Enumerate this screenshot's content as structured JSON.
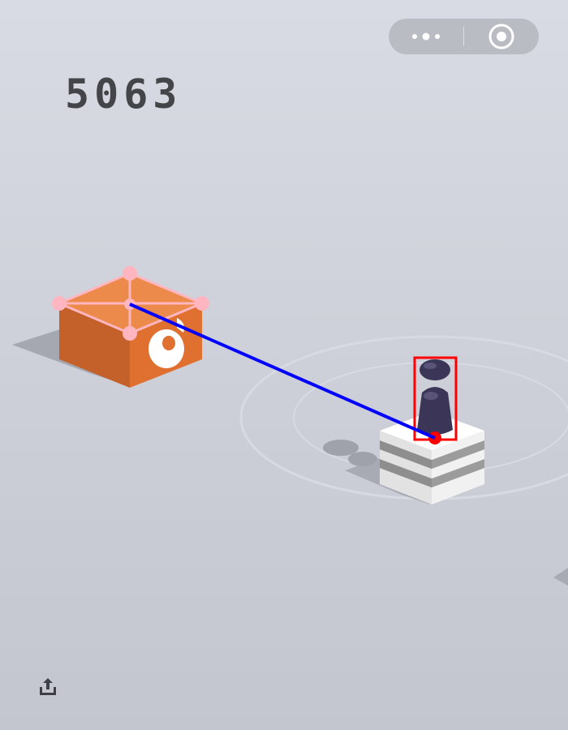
{
  "game": {
    "score": "5063",
    "player_color": "#3b3557",
    "current_platform_color": "#ececec",
    "target_platform_color": "#e0702f",
    "trajectory_color": "#0000ff",
    "player_box_color": "#ff0000",
    "target_marker_color": "#ffb6c1"
  },
  "menu": {
    "more_icon": "more-dots-icon",
    "close_icon": "target-circle-icon"
  },
  "share": {
    "icon": "share-upload-icon"
  }
}
